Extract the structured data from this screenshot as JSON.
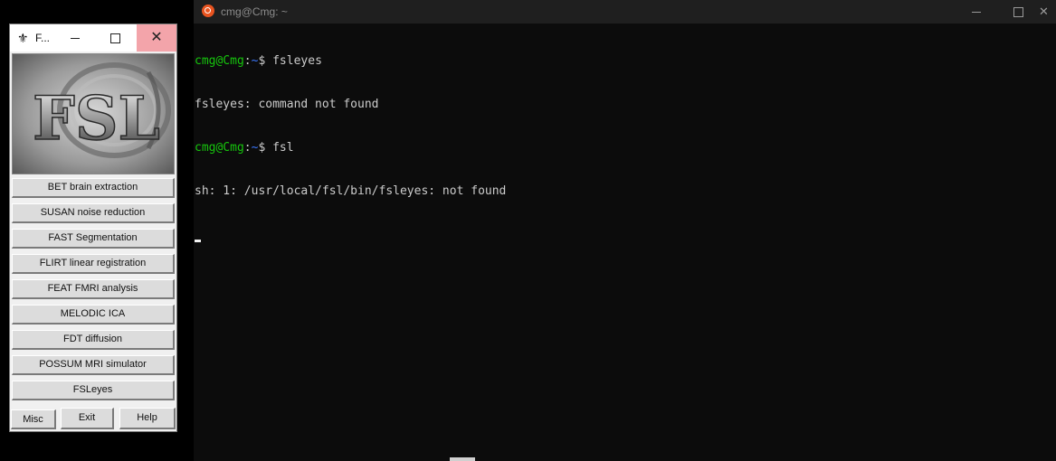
{
  "terminal": {
    "title": "cmg@Cmg: ~",
    "lines": [
      {
        "user": "cmg@Cmg",
        "sep": ":",
        "path": "~",
        "rest": "$ fsleyes"
      },
      {
        "text": "fsleyes: command not found"
      },
      {
        "user": "cmg@Cmg",
        "sep": ":",
        "path": "~",
        "rest": "$ fsl"
      },
      {
        "text": "sh: 1: /usr/local/fsl/bin/fsleyes: not found"
      }
    ],
    "colors": {
      "background": "#0c0c0c",
      "prompt_user": "#16c60c",
      "prompt_path": "#3b78ff",
      "text": "#cccccc"
    }
  },
  "fsl_window": {
    "title": "F...",
    "logo_text": "FSL",
    "buttons": [
      "BET brain extraction",
      "SUSAN noise reduction",
      "FAST Segmentation",
      "FLIRT linear registration",
      "FEAT FMRI analysis",
      "MELODIC ICA",
      "FDT diffusion",
      "POSSUM MRI simulator",
      "FSLeyes"
    ],
    "bottom_buttons": {
      "misc": "Misc",
      "exit": "Exit",
      "help": "Help"
    }
  },
  "icons": {
    "terminal_app": "ubuntu-icon",
    "fsl_app": "fsl-trident-icon",
    "window_controls": [
      "minimize-icon",
      "maximize-icon",
      "close-icon"
    ]
  }
}
